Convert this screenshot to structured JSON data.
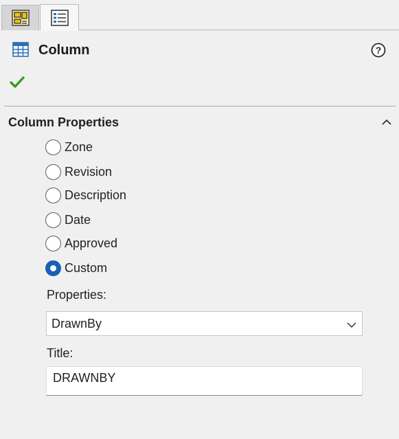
{
  "tabs": [
    {
      "name": "drawing-view-icon",
      "active": false
    },
    {
      "name": "property-manager-icon",
      "active": true
    }
  ],
  "header": {
    "title": "Column",
    "icon": "table-column-icon",
    "help_icon": "help-icon",
    "confirm_icon": "check-icon"
  },
  "section": {
    "title": "Column Properties",
    "collapse_icon": "chevron-up-icon"
  },
  "options": [
    {
      "label": "Zone",
      "checked": false
    },
    {
      "label": "Revision",
      "checked": false
    },
    {
      "label": "Description",
      "checked": false
    },
    {
      "label": "Date",
      "checked": false
    },
    {
      "label": "Approved",
      "checked": false
    },
    {
      "label": "Custom",
      "checked": true
    }
  ],
  "properties": {
    "label": "Properties:",
    "selected": "DrawnBy"
  },
  "title_field": {
    "label": "Title:",
    "value": "DRAWNBY"
  },
  "colors": {
    "accent": "#1a5fb4",
    "check": "#3b9a1f",
    "background": "#f0f0f0"
  }
}
